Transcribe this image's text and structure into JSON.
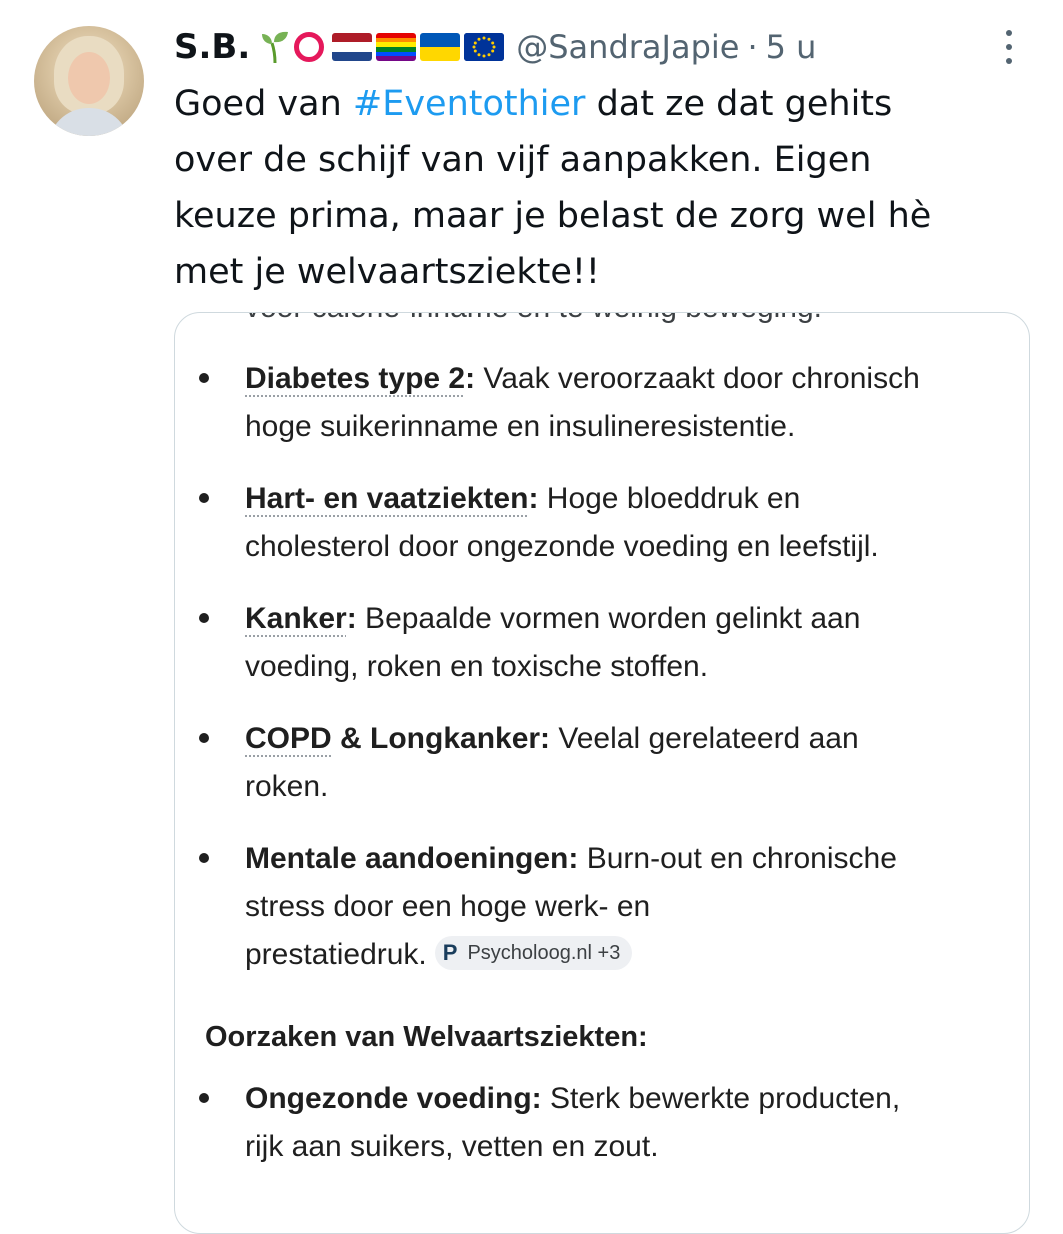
{
  "author": {
    "display_name": "S.B.",
    "handle": "@SandraJapie",
    "separator": "·",
    "time": "5 u",
    "avatar_icon": "profile-photo",
    "badges": [
      "sprout-emoji",
      "red-ring-emoji",
      "netherlands-flag",
      "rainbow-flag",
      "ukraine-flag",
      "eu-flag"
    ]
  },
  "tweet": {
    "line1_before": "Goed van ",
    "hashtag": "#Eventothier",
    "line1_after": " dat ze dat gehits",
    "line2": "over de schijf van vijf aanpakken. Eigen",
    "line3": "keuze prima, maar je belast de zorg wel hè",
    "line4": "met je welvaartsziekte!!"
  },
  "image": {
    "clipped_top_line": "voor calorie-inname en te weinig beweging.",
    "items": [
      {
        "term": "Diabetes type 2",
        "colon": ":",
        "line1": " Vaak veroorzaakt door chronisch",
        "line2": "hoge suikerinname en insulineresistentie."
      },
      {
        "term": "Hart- en vaatziekten",
        "colon": ":",
        "line1": " Hoge bloeddruk en",
        "line2": "cholesterol door ongezonde voeding en leefstijl."
      },
      {
        "term": "Kanker",
        "colon": ":",
        "line1": " Bepaalde vormen worden gelinkt aan",
        "line2": "voeding, roken en toxische stoffen."
      },
      {
        "term": "COPD",
        "term_rest": " & Longkanker:",
        "line1": " Veelal gerelateerd aan",
        "line2": "roken."
      },
      {
        "term": "Mentale aandoeningen:",
        "line1": " Burn-out en chronische",
        "line2": "stress door een hoge werk- en",
        "line3": "prestatiedruk.",
        "source_letter": "P",
        "source_label": "Psycholoog.nl +3"
      }
    ],
    "section_heading": "Oorzaken van Welvaartsziekten:",
    "causes": [
      {
        "term": "Ongezonde voeding:",
        "line1": " Sterk bewerkte producten,",
        "line2": "rijk aan suikers, vetten en zout."
      }
    ]
  },
  "colors": {
    "hashtag": "#1d9bf0",
    "secondary_text": "#536471",
    "card_border": "#cfd9de"
  }
}
